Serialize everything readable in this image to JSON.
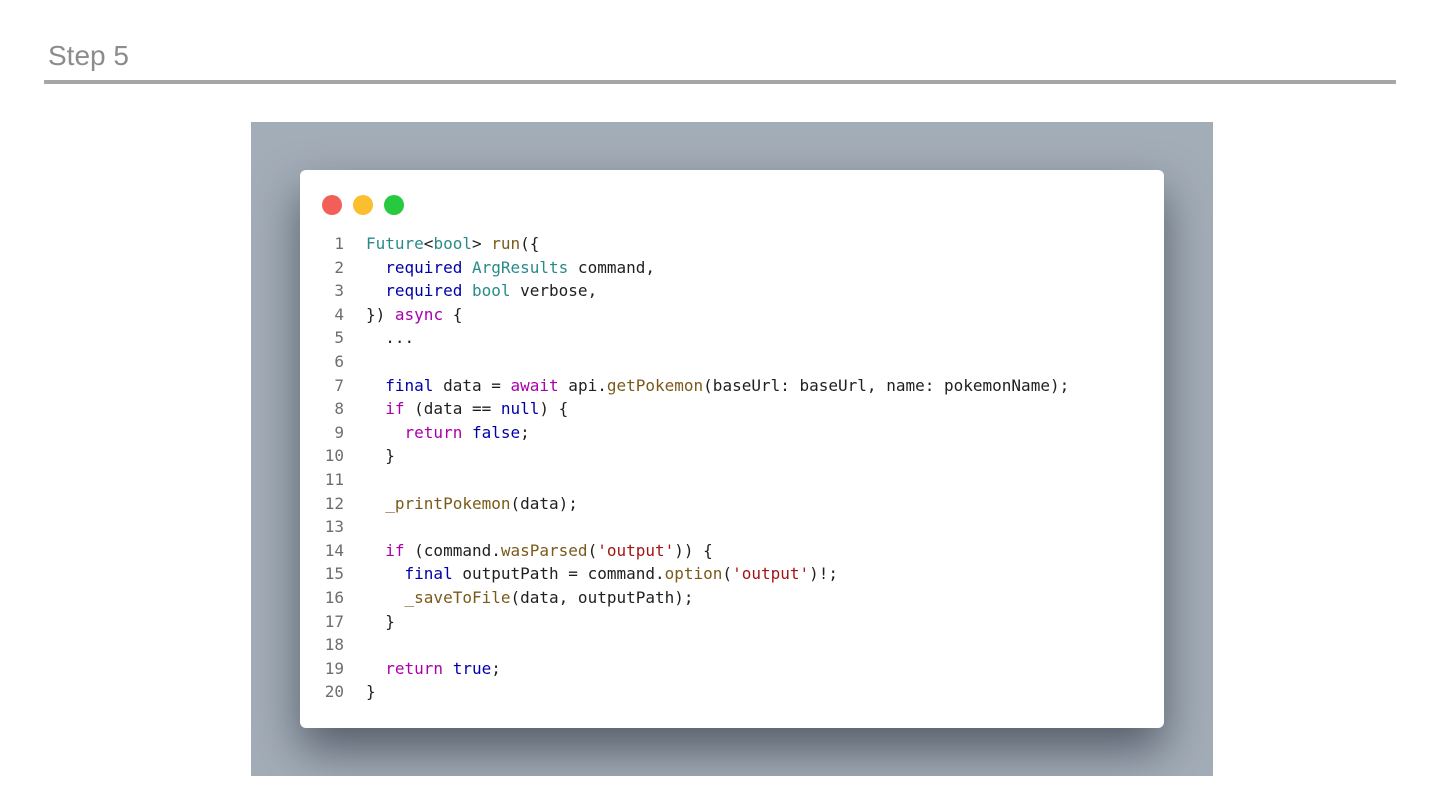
{
  "slide": {
    "title": "Step 5"
  },
  "colors": {
    "title": "#8c8c8c",
    "rule": "#a6a6a6",
    "backdrop": "#a3adb8",
    "window": "#ffffff",
    "dot_close": "#f25f58",
    "dot_minimize": "#fbbe2e",
    "dot_maximize": "#27c93f",
    "keyword": "#0000aa",
    "control": "#aa00aa",
    "type": "#2a8a8a",
    "function": "#7a5a1a",
    "string": "#a31515",
    "plain": "#1f1f1f",
    "line_number": "#6e6e6e"
  },
  "window": {
    "buttons": [
      {
        "name": "close-dot-icon",
        "color": "#f25f58"
      },
      {
        "name": "minimize-dot-icon",
        "color": "#fbbe2e"
      },
      {
        "name": "maximize-dot-icon",
        "color": "#27c93f"
      }
    ]
  },
  "code": {
    "language": "dart",
    "lines": [
      {
        "n": "1",
        "tokens": [
          [
            "Future",
            "type"
          ],
          [
            "<",
            "plain"
          ],
          [
            "bool",
            "type"
          ],
          [
            "> ",
            "plain"
          ],
          [
            "run",
            "function"
          ],
          [
            "({",
            "plain"
          ]
        ]
      },
      {
        "n": "2",
        "tokens": [
          [
            "  ",
            "plain"
          ],
          [
            "required",
            "keyword"
          ],
          [
            " ",
            "plain"
          ],
          [
            "ArgResults",
            "type"
          ],
          [
            " command,",
            "plain"
          ]
        ]
      },
      {
        "n": "3",
        "tokens": [
          [
            "  ",
            "plain"
          ],
          [
            "required",
            "keyword"
          ],
          [
            " ",
            "plain"
          ],
          [
            "bool",
            "type"
          ],
          [
            " verbose,",
            "plain"
          ]
        ]
      },
      {
        "n": "4",
        "tokens": [
          [
            "}) ",
            "plain"
          ],
          [
            "async",
            "control"
          ],
          [
            " {",
            "plain"
          ]
        ]
      },
      {
        "n": "5",
        "tokens": [
          [
            "  ...",
            "plain"
          ]
        ]
      },
      {
        "n": "6",
        "tokens": []
      },
      {
        "n": "7",
        "tokens": [
          [
            "  ",
            "plain"
          ],
          [
            "final",
            "keyword"
          ],
          [
            " data = ",
            "plain"
          ],
          [
            "await",
            "control"
          ],
          [
            " api.",
            "plain"
          ],
          [
            "getPokemon",
            "function"
          ],
          [
            "(baseUrl: baseUrl, name: pokemonName);",
            "plain"
          ]
        ]
      },
      {
        "n": "8",
        "tokens": [
          [
            "  ",
            "plain"
          ],
          [
            "if",
            "control"
          ],
          [
            " (data == ",
            "plain"
          ],
          [
            "null",
            "keyword"
          ],
          [
            ") {",
            "plain"
          ]
        ]
      },
      {
        "n": "9",
        "tokens": [
          [
            "    ",
            "plain"
          ],
          [
            "return",
            "control"
          ],
          [
            " ",
            "plain"
          ],
          [
            "false",
            "keyword"
          ],
          [
            ";",
            "plain"
          ]
        ]
      },
      {
        "n": "10",
        "tokens": [
          [
            "  }",
            "plain"
          ]
        ]
      },
      {
        "n": "11",
        "tokens": []
      },
      {
        "n": "12",
        "tokens": [
          [
            "  ",
            "plain"
          ],
          [
            "_printPokemon",
            "function"
          ],
          [
            "(data);",
            "plain"
          ]
        ]
      },
      {
        "n": "13",
        "tokens": []
      },
      {
        "n": "14",
        "tokens": [
          [
            "  ",
            "plain"
          ],
          [
            "if",
            "control"
          ],
          [
            " (command.",
            "plain"
          ],
          [
            "wasParsed",
            "function"
          ],
          [
            "(",
            "plain"
          ],
          [
            "'output'",
            "string"
          ],
          [
            ")) {",
            "plain"
          ]
        ]
      },
      {
        "n": "15",
        "tokens": [
          [
            "    ",
            "plain"
          ],
          [
            "final",
            "keyword"
          ],
          [
            " outputPath = command.",
            "plain"
          ],
          [
            "option",
            "function"
          ],
          [
            "(",
            "plain"
          ],
          [
            "'output'",
            "string"
          ],
          [
            ")!;",
            "plain"
          ]
        ]
      },
      {
        "n": "16",
        "tokens": [
          [
            "    ",
            "plain"
          ],
          [
            "_saveToFile",
            "function"
          ],
          [
            "(data, outputPath);",
            "plain"
          ]
        ]
      },
      {
        "n": "17",
        "tokens": [
          [
            "  }",
            "plain"
          ]
        ]
      },
      {
        "n": "18",
        "tokens": []
      },
      {
        "n": "19",
        "tokens": [
          [
            "  ",
            "plain"
          ],
          [
            "return",
            "control"
          ],
          [
            " ",
            "plain"
          ],
          [
            "true",
            "keyword"
          ],
          [
            ";",
            "plain"
          ]
        ]
      },
      {
        "n": "20",
        "tokens": [
          [
            "}",
            "plain"
          ]
        ]
      }
    ]
  }
}
